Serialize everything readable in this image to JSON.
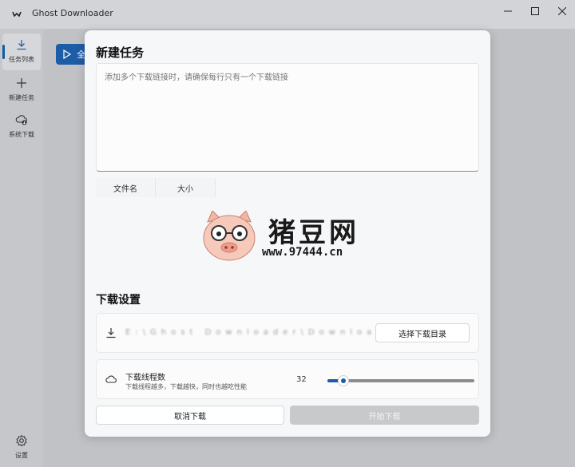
{
  "window": {
    "title": "Ghost Downloader",
    "controls": [
      "minimize-icon",
      "maximize-icon",
      "close-icon"
    ]
  },
  "sidebar": {
    "items": [
      {
        "label": "任务列表",
        "icon": "download-icon",
        "active": true
      },
      {
        "label": "新建任务",
        "icon": "plus-icon",
        "active": false
      },
      {
        "label": "系统下载",
        "icon": "cloud-download-icon",
        "active": false
      }
    ],
    "settings_label": "设置"
  },
  "background": {
    "primary_button_label": "全"
  },
  "dialog": {
    "title": "新建任务",
    "url_input": {
      "placeholder": "添加多个下载链接时，请确保每行只有一个下载链接",
      "value": ""
    },
    "file_table": {
      "columns": [
        "文件名",
        "大小"
      ]
    },
    "settings_title": "下载设置",
    "directory": {
      "path": "E:\\Ghost Downloader\\Downloads",
      "button_label": "选择下载目录"
    },
    "threads": {
      "title": "下载线程数",
      "description": "下载线程越多，下载越快，同时也越吃性能",
      "value": "32",
      "fraction": 0.11
    },
    "cancel_label": "取消下载",
    "start_label": "开始下载"
  },
  "watermark": {
    "text": "猪豆网",
    "url": "www.97444.cn"
  },
  "colors": {
    "accent": "#1d5ca6",
    "disabled": "#c8c9cb"
  }
}
